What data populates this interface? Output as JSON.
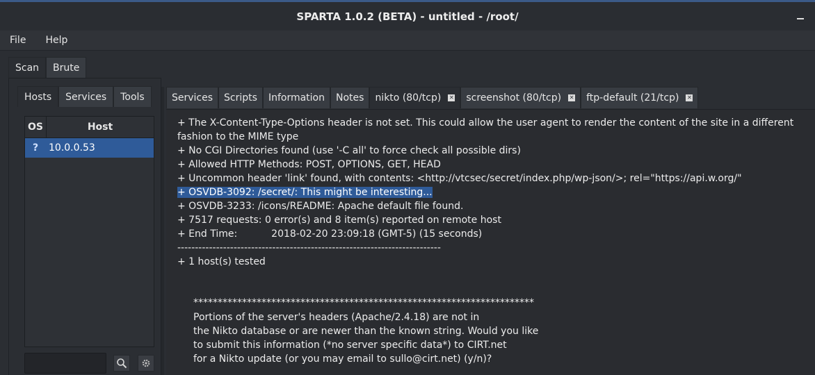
{
  "window": {
    "title": "SPARTA 1.0.2 (BETA) - untitled - /root/"
  },
  "menu": {
    "items": [
      "File",
      "Help"
    ]
  },
  "main_tabs": [
    {
      "label": "Scan"
    },
    {
      "label": "Brute"
    }
  ],
  "left_tabs": [
    {
      "label": "Hosts"
    },
    {
      "label": "Services"
    },
    {
      "label": "Tools"
    }
  ],
  "hosts": {
    "columns": {
      "os": "OS",
      "host": "Host"
    },
    "rows": [
      {
        "os": "?",
        "host": "10.0.0.53"
      }
    ]
  },
  "right_tabs": [
    {
      "label": "Services"
    },
    {
      "label": "Scripts"
    },
    {
      "label": "Information"
    },
    {
      "label": "Notes"
    },
    {
      "label": "nikto (80/tcp)"
    },
    {
      "label": "screenshot (80/tcp)"
    },
    {
      "label": "ftp-default (21/tcp)"
    }
  ],
  "output": {
    "lines": [
      "+ The X-Content-Type-Options header is not set. This could allow the user agent to render the content of the site in a different fashion to the MIME type",
      "+ No CGI Directories found (use '-C all' to force check all possible dirs)",
      "+ Allowed HTTP Methods: POST, OPTIONS, GET, HEAD",
      "+ Uncommon header 'link' found, with contents: <http://vtcsec/secret/index.php/wp-json/>; rel=\"https://api.w.org/\"",
      "+ OSVDB-3092: /secret/: This might be interesting...",
      "+ OSVDB-3233: /icons/README: Apache default file found.",
      "+ 7517 requests: 0 error(s) and 8 item(s) reported on remote host",
      "+ End Time:           2018-02-20 23:09:18 (GMT-5) (15 seconds)",
      "---------------------------------------------------------------------------",
      "+ 1 host(s) tested",
      "**********************************************************************",
      "Portions of the server's headers (Apache/2.4.18) are not in",
      "the Nikto database or are newer than the known string. Would you like",
      "to submit this information (*no server specific data*) to CIRT.net",
      "for a Nikto update (or you may email to sullo@cirt.net) (y/n)?"
    ]
  },
  "colors": {
    "selection": "#2f5b99",
    "background": "#2b2e33",
    "title_accent": "#3b5a88"
  }
}
